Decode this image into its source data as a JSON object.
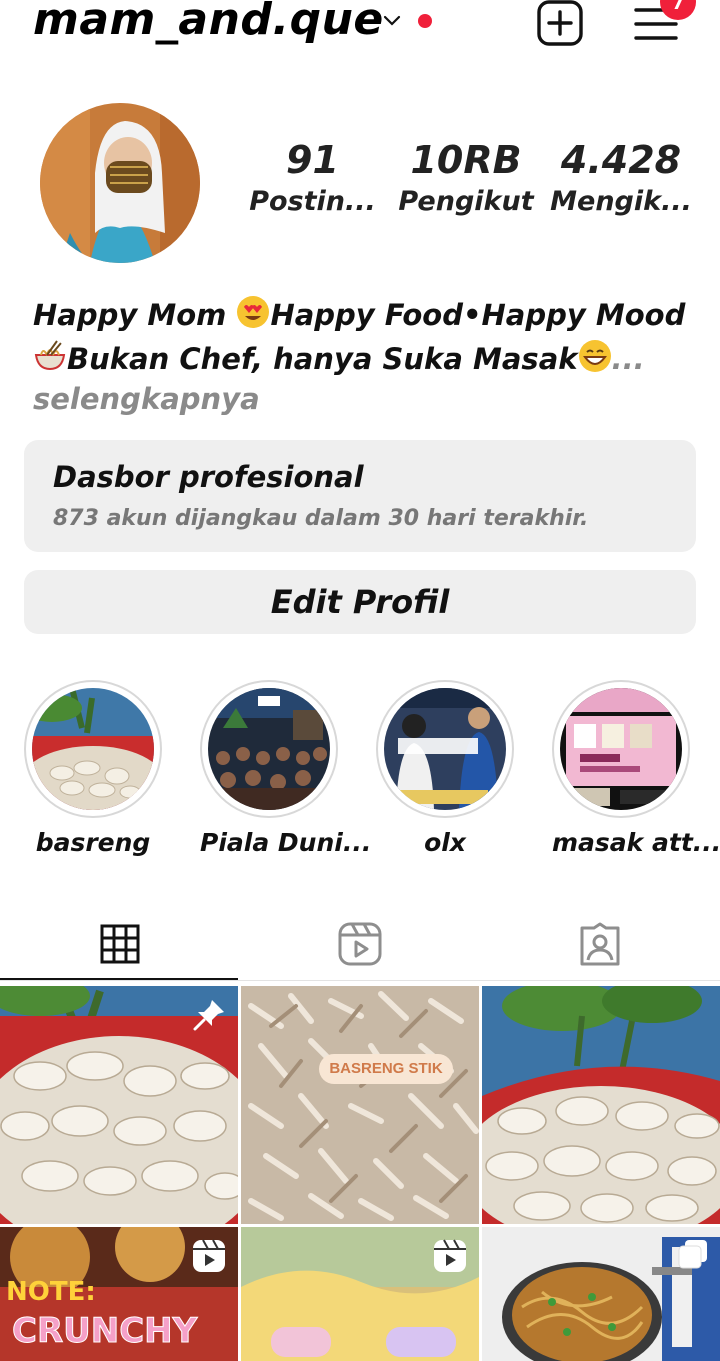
{
  "header": {
    "username": "mam_and.que",
    "menu_badge": "7"
  },
  "profile": {
    "stats": [
      {
        "value": "91",
        "label": "Postin..."
      },
      {
        "value": "10RB",
        "label": "Pengikut"
      },
      {
        "value": "4.428",
        "label": "Mengik..."
      }
    ],
    "bio_line1": "Happy Mom ",
    "bio_line1b": "Happy Food•Happy Mood",
    "bio_line2": "Bukan Chef, hanya Suka Masak",
    "bio_ellipsis": "...",
    "bio_more": "selengkapnya"
  },
  "dashboard": {
    "title": "Dasbor profesional",
    "subtitle": "873 akun dijangkau dalam 30 hari terakhir."
  },
  "edit_profile_label": "Edit Profil",
  "highlights": [
    {
      "label": "basreng"
    },
    {
      "label": "Piala Duni..."
    },
    {
      "label": "olx"
    },
    {
      "label": "masak att..."
    }
  ],
  "grid": {
    "post2_overlay": "BASRENG STIK",
    "post4_text1": "NOTE:",
    "post4_text2": "CRUNCHY"
  },
  "colors": {
    "accent_red": "#f0203a",
    "button_bg": "#efefef"
  }
}
